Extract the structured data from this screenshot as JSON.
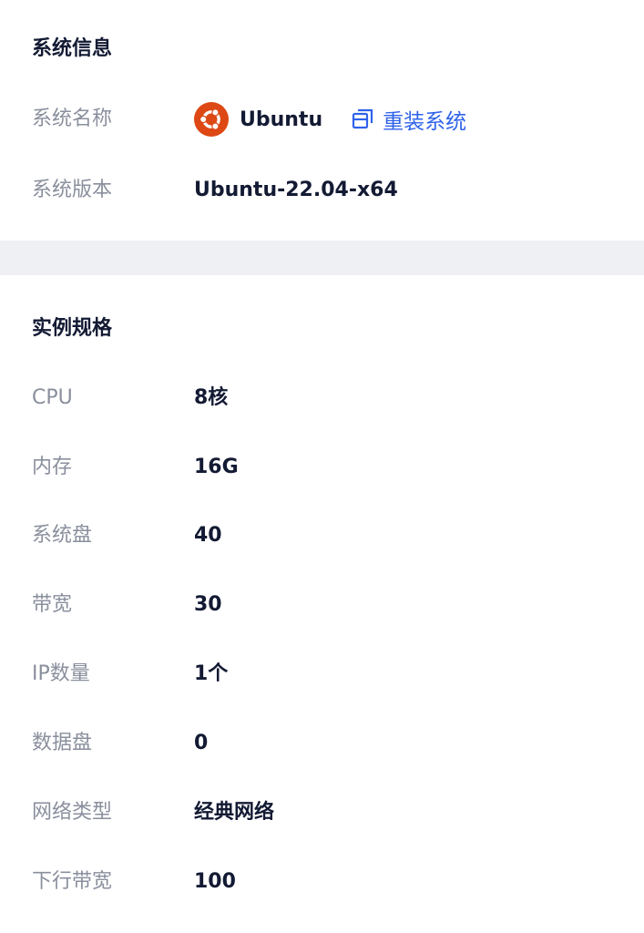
{
  "system_info": {
    "title": "系统信息",
    "os_label": "系统名称",
    "os_name": "Ubuntu",
    "os_icon": "ubuntu-logo",
    "reinstall_label": "重装系统",
    "reinstall_icon": "reinstall-icon",
    "version_label": "系统版本",
    "version_value": "Ubuntu-22.04-x64"
  },
  "instance_spec": {
    "title": "实例规格",
    "rows": [
      {
        "label": "CPU",
        "value": "8核"
      },
      {
        "label": "内存",
        "value": "16G"
      },
      {
        "label": "系统盘",
        "value": "40"
      },
      {
        "label": "带宽",
        "value": "30"
      },
      {
        "label": "IP数量",
        "value": "1个"
      },
      {
        "label": "数据盘",
        "value": "0"
      },
      {
        "label": "网络类型",
        "value": "经典网络"
      },
      {
        "label": "下行带宽",
        "value": "100"
      }
    ]
  },
  "colors": {
    "accent": "#2f63ea",
    "ubuntu_orange": "#dd4814",
    "label_gray": "#8a8f9d",
    "divider_bg": "#eef0f4"
  }
}
